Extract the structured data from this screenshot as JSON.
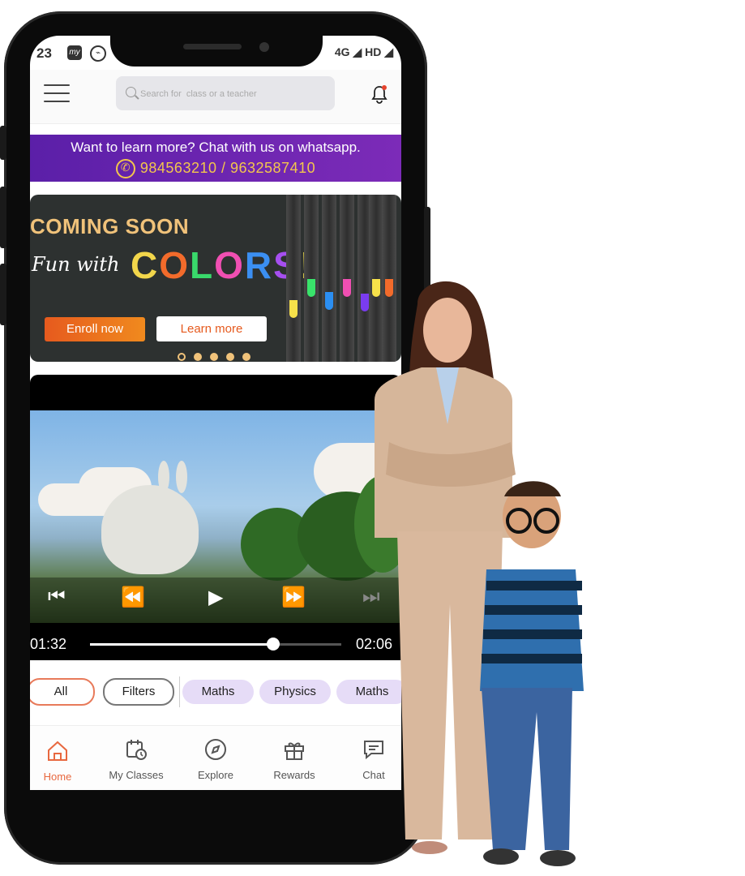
{
  "status_bar": {
    "time": "23",
    "icon1": "my",
    "network": "4G",
    "quality": "HD"
  },
  "search": {
    "placeholder": "Search for  class or a teacher"
  },
  "whatsapp_banner": {
    "line1": "Want to learn more? Chat with us on whatsapp.",
    "numbers": "984563210 / 9632587410"
  },
  "promo": {
    "heading": "COMING SOON",
    "script": "Fun with",
    "colors_word": "COLORS!",
    "enroll_label": "Enroll now",
    "learn_label": "Learn more",
    "slides": 5,
    "active_slide": 1
  },
  "video": {
    "current_time": "01:32",
    "total_time": "02:06",
    "progress": 0.73
  },
  "chips": [
    "All",
    "Filters",
    "Maths",
    "Physics",
    "Maths"
  ],
  "tabs": [
    {
      "label": "Home",
      "icon": "home-icon",
      "active": true
    },
    {
      "label": "My Classes",
      "icon": "calendar-clock-icon",
      "active": false
    },
    {
      "label": "Explore",
      "icon": "compass-icon",
      "active": false
    },
    {
      "label": "Rewards",
      "icon": "gift-icon",
      "active": false
    },
    {
      "label": "Chat",
      "icon": "chat-icon",
      "active": false
    }
  ],
  "colors": {
    "accent": "#e8683f",
    "banner_purple": "#6a25b0",
    "whatsapp_yellow": "#f3c64c",
    "chip_lilac": "#e6dcf7"
  }
}
